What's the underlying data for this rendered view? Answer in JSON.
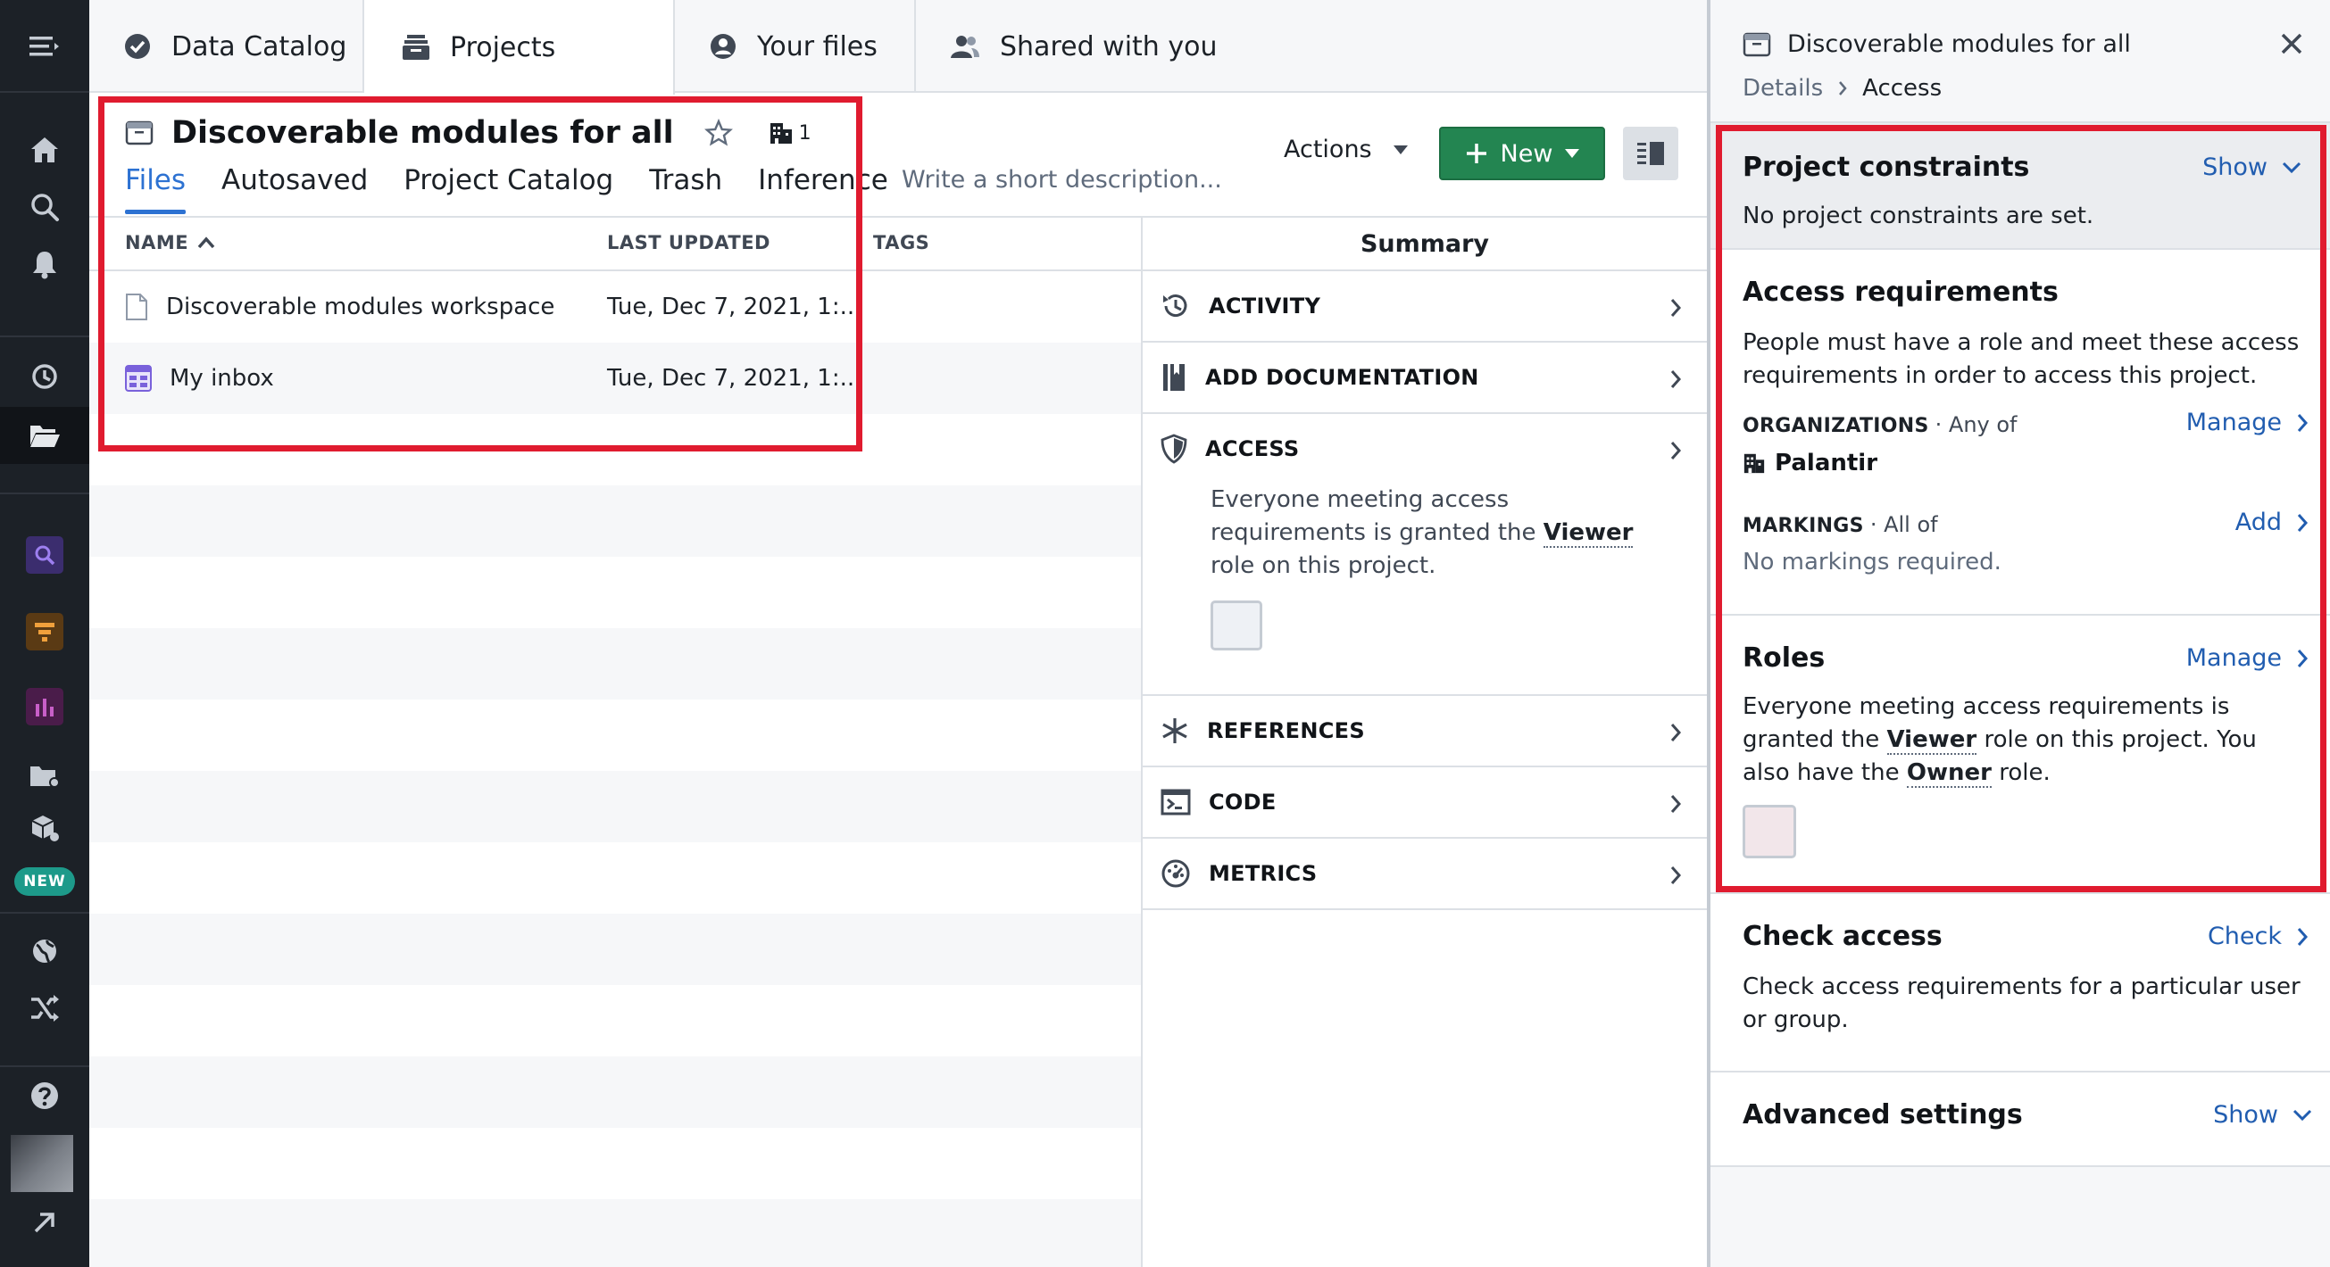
{
  "nav_tabs": [
    {
      "label": "Data Catalog",
      "icon": "check-circle-icon"
    },
    {
      "label": "Projects",
      "icon": "projects-icon",
      "active": true
    },
    {
      "label": "Your files",
      "icon": "user-circle-icon"
    },
    {
      "label": "Shared with you",
      "icon": "people-icon"
    }
  ],
  "project": {
    "title": "Discoverable modules for all",
    "org_count": "1",
    "description_placeholder": "Write a short description...",
    "subtabs": [
      "Files",
      "Autosaved",
      "Project Catalog",
      "Trash",
      "Inference"
    ],
    "actions_label": "Actions",
    "new_label": "New"
  },
  "table": {
    "columns": [
      "NAME",
      "LAST UPDATED",
      "TAGS"
    ],
    "rows": [
      {
        "name": "Discoverable modules workspace",
        "updated": "Tue, Dec 7, 2021, 1:...",
        "icon": "document-icon"
      },
      {
        "name": "My inbox",
        "updated": "Tue, Dec 7, 2021, 1:...",
        "icon": "inbox-icon"
      }
    ]
  },
  "summary": {
    "title": "Summary",
    "items": [
      {
        "label": "ACTIVITY",
        "icon": "history-icon"
      },
      {
        "label": "ADD DOCUMENTATION",
        "icon": "book-icon"
      },
      {
        "label": "ACCESS",
        "icon": "shield-icon",
        "text_before": "Everyone meeting access requirements is granted the",
        "role": "Viewer",
        "text_after": "role on this project."
      },
      {
        "label": "REFERENCES",
        "icon": "asterisk-icon"
      },
      {
        "label": "CODE",
        "icon": "terminal-icon"
      },
      {
        "label": "METRICS",
        "icon": "dashboard-icon"
      }
    ]
  },
  "drawer": {
    "title": "Discoverable modules for all",
    "breadcrumb": [
      "Details",
      "Access"
    ],
    "project_constraints": {
      "title": "Project constraints",
      "link": "Show",
      "text": "No project constraints are set."
    },
    "access_requirements": {
      "title": "Access requirements",
      "text": "People must have a role and meet these access requirements in order to access this project.",
      "organizations": {
        "label": "ORGANIZATIONS",
        "qualifier": "· Any of",
        "link": "Manage",
        "value": "Palantir"
      },
      "markings": {
        "label": "MARKINGS",
        "qualifier": "· All of",
        "link": "Add",
        "value": "No markings required."
      }
    },
    "roles": {
      "title": "Roles",
      "link": "Manage",
      "text_1": "Everyone meeting access requirements is granted the",
      "role_1": "Viewer",
      "text_2": "role on this project. You also have the",
      "role_2": "Owner",
      "text_3": "role."
    },
    "check_access": {
      "title": "Check access",
      "link": "Check",
      "text": "Check access requirements for a particular user or group."
    },
    "advanced": {
      "title": "Advanced settings",
      "link": "Show"
    }
  },
  "sidebar": {
    "new_badge": "NEW"
  },
  "colors": {
    "accent": "#2d72d2",
    "primary_green": "#238551",
    "highlight_red": "#e01b2f",
    "rail": "#1c2127"
  }
}
